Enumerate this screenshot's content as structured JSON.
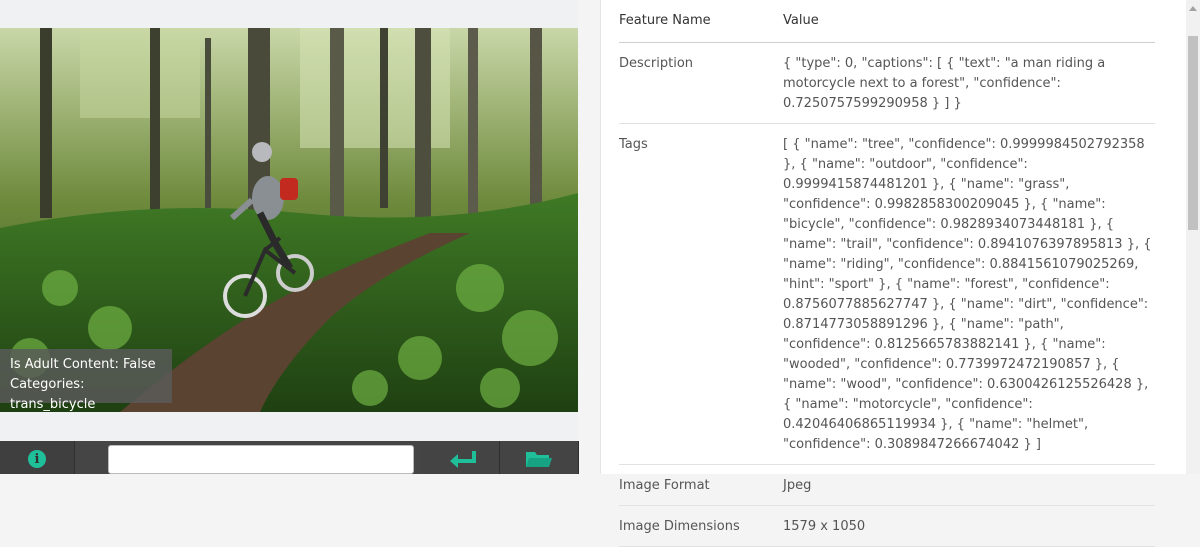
{
  "image": {
    "overlay": {
      "adult": "Is Adult Content: False",
      "categories": "Categories: trans_bicycle"
    }
  },
  "toolbar": {
    "url_value": "",
    "url_placeholder": "",
    "icons": [
      "info-icon",
      "enter-icon",
      "folder-icon"
    ],
    "accent_color": "#1fbf9a"
  },
  "table": {
    "headers": [
      "Feature Name",
      "Value"
    ],
    "rows": [
      {
        "name": "Description",
        "value": "{ \"type\": 0, \"captions\": [ { \"text\": \"a man riding a motorcycle next to a forest\", \"confidence\": 0.7250757599290958 } ] }"
      },
      {
        "name": "Tags",
        "value": "[ { \"name\": \"tree\", \"confidence\": 0.9999984502792358 }, { \"name\": \"outdoor\", \"confidence\": 0.9999415874481201 }, { \"name\": \"grass\", \"confidence\": 0.9982858300209045 }, { \"name\": \"bicycle\", \"confidence\": 0.9828934073448181 }, { \"name\": \"trail\", \"confidence\": 0.8941076397895813 }, { \"name\": \"riding\", \"confidence\": 0.8841561079025269, \"hint\": \"sport\" }, { \"name\": \"forest\", \"confidence\": 0.8756077885627747 }, { \"name\": \"dirt\", \"confidence\": 0.8714773058891296 }, { \"name\": \"path\", \"confidence\": 0.8125665783882141 }, { \"name\": \"wooded\", \"confidence\": 0.7739972472190857 }, { \"name\": \"wood\", \"confidence\": 0.6300426125526428 }, { \"name\": \"motorcycle\", \"confidence\": 0.42046406865119934 }, { \"name\": \"helmet\", \"confidence\": 0.3089847266674042 } ]"
      },
      {
        "name": "Image Format",
        "value": "Jpeg"
      },
      {
        "name": "Image Dimensions",
        "value": "1579 x 1050"
      }
    ]
  }
}
